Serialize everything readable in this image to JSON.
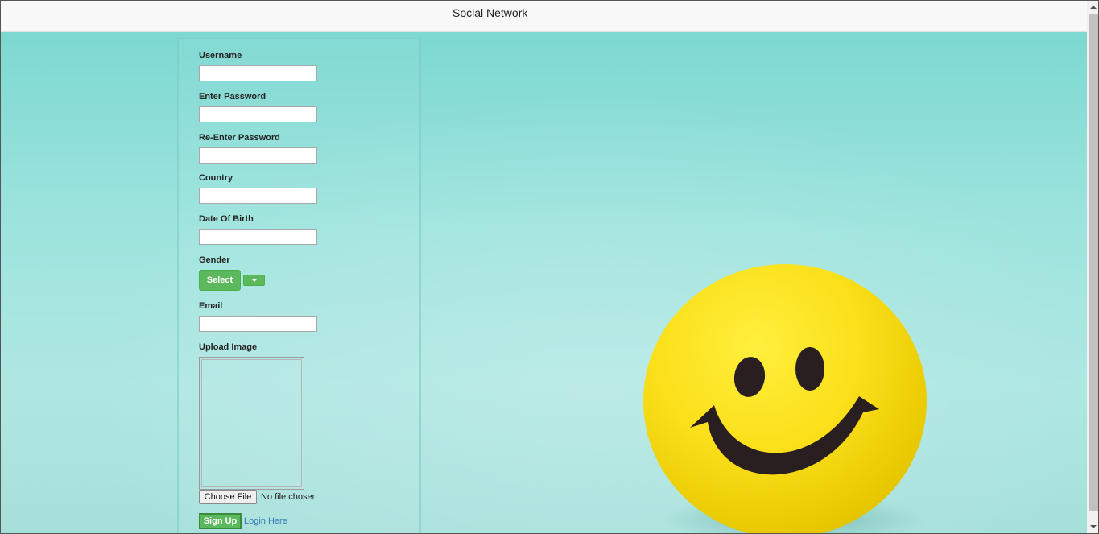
{
  "navbar": {
    "brand": "Social Network"
  },
  "form": {
    "username_label": "Username",
    "password_label": "Enter Password",
    "repassword_label": "Re-Enter Password",
    "country_label": "Country",
    "dob_label": "Date Of Birth",
    "gender_label": "Gender",
    "gender_select_label": "Select",
    "email_label": "Email",
    "upload_label": "Upload Image",
    "choose_file_label": "Choose File",
    "no_file_text": "No file chosen",
    "signup_label": "Sign Up",
    "login_link": "Login Here"
  },
  "colors": {
    "accent_green": "#5cb85c",
    "link_blue": "#337ab7",
    "background_teal": "#9fe4de",
    "smiley_yellow": "#fbe01a"
  },
  "icons": {
    "dropdown": "caret-down-icon",
    "background": "smiley-ball-image"
  }
}
